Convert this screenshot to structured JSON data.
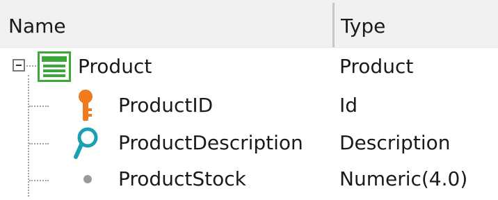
{
  "header": {
    "name_label": "Name",
    "type_label": "Type"
  },
  "tree": {
    "root": {
      "name": "Product",
      "type": "Product",
      "icon": "transaction-table-icon",
      "expanded": true
    },
    "children": [
      {
        "name": "ProductID",
        "type": "Id",
        "icon": "key-icon"
      },
      {
        "name": "ProductDescription",
        "type": "Description",
        "icon": "description-key-icon"
      },
      {
        "name": "ProductStock",
        "type": "Numeric(4.0)",
        "icon": "attribute-dot-icon"
      }
    ]
  },
  "colors": {
    "header_bg": "#f1f1f1",
    "table_icon_green": "#3aa83a",
    "key_orange": "#f07a1e",
    "description_teal": "#1aa0b0",
    "attribute_gray": "#9a9a9a"
  }
}
